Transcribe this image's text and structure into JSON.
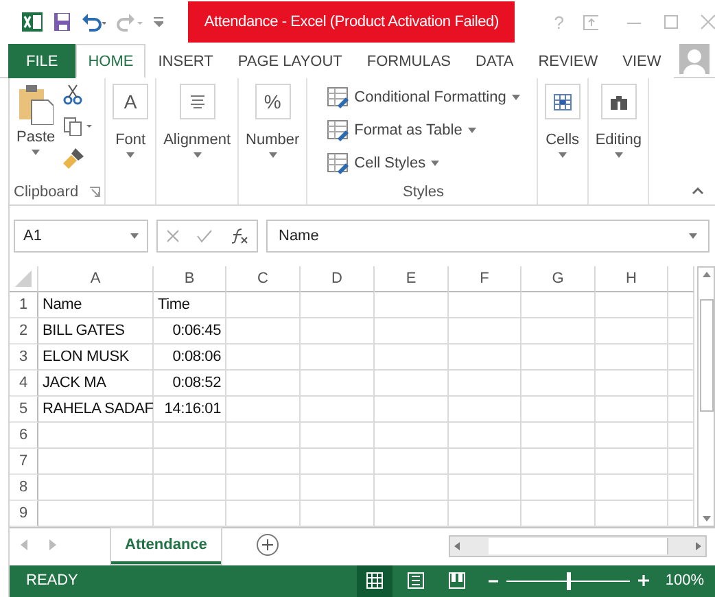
{
  "window": {
    "title": "Attendance - Excel (Product Activation Failed)",
    "help": "?"
  },
  "tabs": [
    {
      "label": "FILE",
      "kind": "file",
      "selected": false
    },
    {
      "label": "HOME",
      "kind": "tab",
      "selected": true
    },
    {
      "label": "INSERT",
      "kind": "tab",
      "selected": false
    },
    {
      "label": "PAGE LAYOUT",
      "kind": "tab",
      "selected": false
    },
    {
      "label": "FORMULAS",
      "kind": "tab",
      "selected": false
    },
    {
      "label": "DATA",
      "kind": "tab",
      "selected": false
    },
    {
      "label": "REVIEW",
      "kind": "tab",
      "selected": false
    },
    {
      "label": "VIEW",
      "kind": "tab",
      "selected": false
    }
  ],
  "ribbon": {
    "groups": [
      {
        "kind": "clipboard",
        "button": "Paste",
        "label": "Clipboard"
      },
      {
        "kind": "font",
        "label": "Font",
        "glyph": "A"
      },
      {
        "kind": "alignment",
        "label": "Alignment"
      },
      {
        "kind": "number",
        "label": "Number",
        "glyph": "%"
      },
      {
        "kind": "styles",
        "items": [
          "Conditional Formatting",
          "Format as Table",
          "Cell Styles"
        ],
        "label": "Styles"
      },
      {
        "kind": "cells",
        "label": "Cells"
      },
      {
        "kind": "editing",
        "label": "Editing"
      }
    ]
  },
  "formula_bar": {
    "name_box": "A1",
    "formula": "Name"
  },
  "sheet": {
    "columns": [
      "A",
      "B",
      "C",
      "D",
      "E",
      "F",
      "G",
      "H"
    ],
    "rows": [
      {
        "number": "1",
        "cells": [
          "Name",
          "Time"
        ]
      },
      {
        "number": "2",
        "cells": [
          "BILL GATES",
          "0:06:45"
        ]
      },
      {
        "number": "3",
        "cells": [
          "ELON MUSK",
          "0:08:06"
        ]
      },
      {
        "number": "4",
        "cells": [
          "JACK MA",
          "0:08:52"
        ]
      },
      {
        "number": "5",
        "cells": [
          "RAHELA SADAF",
          "14:16:01"
        ]
      },
      {
        "number": "6",
        "cells": []
      },
      {
        "number": "7",
        "cells": []
      },
      {
        "number": "8",
        "cells": []
      },
      {
        "number": "9",
        "cells": []
      }
    ]
  },
  "sheet_tabs": [
    {
      "label": "Attendance",
      "selected": true
    }
  ],
  "status_bar": {
    "status": "READY",
    "views": [
      {
        "kind": "normal",
        "selected": true
      },
      {
        "kind": "layout",
        "selected": false
      },
      {
        "kind": "break",
        "selected": false
      }
    ],
    "zoom": {
      "level": 0.5,
      "reading": "100%"
    }
  }
}
